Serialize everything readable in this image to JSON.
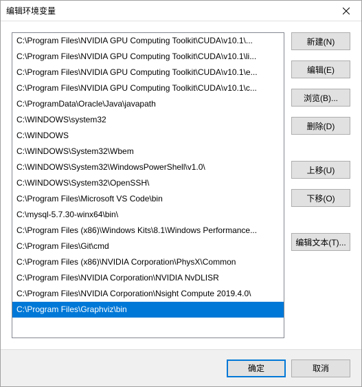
{
  "title": "编辑环境变量",
  "items": [
    "C:\\Program Files\\NVIDIA GPU Computing Toolkit\\CUDA\\v10.1\\...",
    "C:\\Program Files\\NVIDIA GPU Computing Toolkit\\CUDA\\v10.1\\li...",
    "C:\\Program Files\\NVIDIA GPU Computing Toolkit\\CUDA\\v10.1\\e...",
    "C:\\Program Files\\NVIDIA GPU Computing Toolkit\\CUDA\\v10.1\\c...",
    "C:\\ProgramData\\Oracle\\Java\\javapath",
    "C:\\WINDOWS\\system32",
    "C:\\WINDOWS",
    "C:\\WINDOWS\\System32\\Wbem",
    "C:\\WINDOWS\\System32\\WindowsPowerShell\\v1.0\\",
    "C:\\WINDOWS\\System32\\OpenSSH\\",
    "C:\\Program Files\\Microsoft VS Code\\bin",
    "C:\\mysql-5.7.30-winx64\\bin\\",
    "C:\\Program Files (x86)\\Windows Kits\\8.1\\Windows Performance...",
    "C:\\Program Files\\Git\\cmd",
    "C:\\Program Files (x86)\\NVIDIA Corporation\\PhysX\\Common",
    "C:\\Program Files\\NVIDIA Corporation\\NVIDIA NvDLISR",
    "C:\\Program Files\\NVIDIA Corporation\\Nsight Compute 2019.4.0\\",
    "C:\\Program Files\\Graphviz\\bin"
  ],
  "selectedIndex": 17,
  "buttons": {
    "new": "新建(N)",
    "edit": "编辑(E)",
    "browse": "浏览(B)...",
    "delete": "删除(D)",
    "moveUp": "上移(U)",
    "moveDown": "下移(O)",
    "editText": "编辑文本(T)...",
    "ok": "确定",
    "cancel": "取消"
  }
}
